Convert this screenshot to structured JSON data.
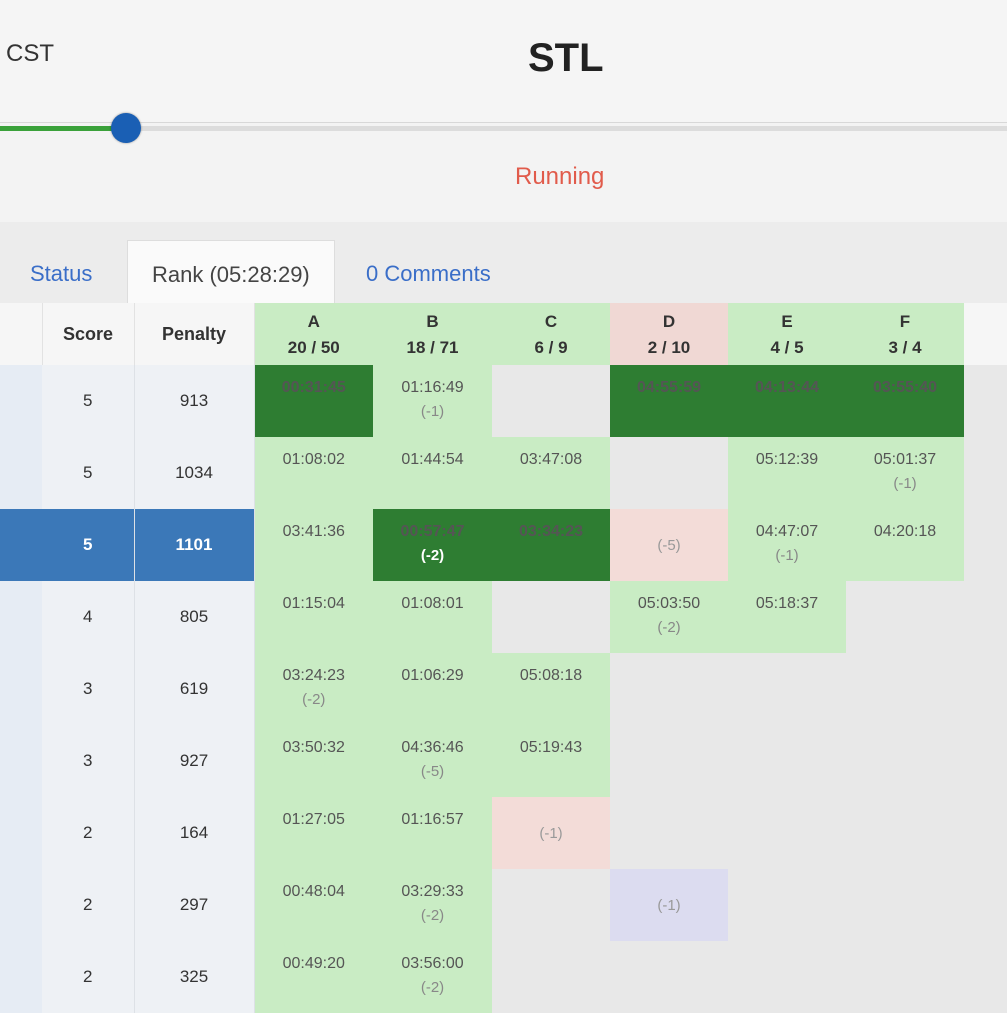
{
  "header": {
    "timezone": "CST",
    "title": "STL",
    "progress": 0.125,
    "status": "Running"
  },
  "tabs": [
    {
      "label": "Status"
    },
    {
      "label": "Rank (05:28:29)"
    },
    {
      "label": "0 Comments"
    }
  ],
  "table": {
    "score_header": "Score",
    "penalty_header": "Penalty",
    "problems": [
      {
        "letter": "A",
        "stats": "20 / 50",
        "state": "solved"
      },
      {
        "letter": "B",
        "stats": "18 / 71",
        "state": "solved"
      },
      {
        "letter": "C",
        "stats": "6 / 9",
        "state": "solved"
      },
      {
        "letter": "D",
        "stats": "2 / 10",
        "state": "unsolved"
      },
      {
        "letter": "E",
        "stats": "4 / 5",
        "state": "solved"
      },
      {
        "letter": "F",
        "stats": "3 / 4",
        "state": "solved"
      }
    ],
    "rows": [
      {
        "score": "5",
        "penalty": "913",
        "highlight": false,
        "cells": [
          {
            "s": "first",
            "t": "00:31:45",
            "n": ""
          },
          {
            "s": "solved",
            "t": "01:16:49",
            "n": "(-1)"
          },
          {
            "s": "empty",
            "t": "",
            "n": ""
          },
          {
            "s": "first",
            "t": "04:55:59",
            "n": ""
          },
          {
            "s": "first",
            "t": "04:13:44",
            "n": ""
          },
          {
            "s": "first",
            "t": "03:55:40",
            "n": ""
          }
        ]
      },
      {
        "score": "5",
        "penalty": "1034",
        "highlight": false,
        "cells": [
          {
            "s": "solved",
            "t": "01:08:02",
            "n": ""
          },
          {
            "s": "solved",
            "t": "01:44:54",
            "n": ""
          },
          {
            "s": "solved",
            "t": "03:47:08",
            "n": ""
          },
          {
            "s": "empty",
            "t": "",
            "n": ""
          },
          {
            "s": "solved",
            "t": "05:12:39",
            "n": ""
          },
          {
            "s": "solved",
            "t": "05:01:37",
            "n": "(-1)"
          }
        ]
      },
      {
        "score": "5",
        "penalty": "1101",
        "highlight": true,
        "cells": [
          {
            "s": "solved",
            "t": "03:41:36",
            "n": ""
          },
          {
            "s": "first",
            "t": "00:57:47",
            "n": "(-2)"
          },
          {
            "s": "first",
            "t": "03:34:23",
            "n": ""
          },
          {
            "s": "failed",
            "t": "",
            "n": "(-5)"
          },
          {
            "s": "solved",
            "t": "04:47:07",
            "n": "(-1)"
          },
          {
            "s": "solved",
            "t": "04:20:18",
            "n": ""
          }
        ]
      },
      {
        "score": "4",
        "penalty": "805",
        "highlight": false,
        "cells": [
          {
            "s": "solved",
            "t": "01:15:04",
            "n": ""
          },
          {
            "s": "solved",
            "t": "01:08:01",
            "n": ""
          },
          {
            "s": "empty",
            "t": "",
            "n": ""
          },
          {
            "s": "solved",
            "t": "05:03:50",
            "n": "(-2)"
          },
          {
            "s": "solved",
            "t": "05:18:37",
            "n": ""
          },
          {
            "s": "empty",
            "t": "",
            "n": ""
          }
        ]
      },
      {
        "score": "3",
        "penalty": "619",
        "highlight": false,
        "cells": [
          {
            "s": "solved",
            "t": "03:24:23",
            "n": "(-2)"
          },
          {
            "s": "solved",
            "t": "01:06:29",
            "n": ""
          },
          {
            "s": "solved",
            "t": "05:08:18",
            "n": ""
          },
          {
            "s": "empty",
            "t": "",
            "n": ""
          },
          {
            "s": "empty",
            "t": "",
            "n": ""
          },
          {
            "s": "empty",
            "t": "",
            "n": ""
          }
        ]
      },
      {
        "score": "3",
        "penalty": "927",
        "highlight": false,
        "cells": [
          {
            "s": "solved",
            "t": "03:50:32",
            "n": ""
          },
          {
            "s": "solved",
            "t": "04:36:46",
            "n": "(-5)"
          },
          {
            "s": "solved",
            "t": "05:19:43",
            "n": ""
          },
          {
            "s": "empty",
            "t": "",
            "n": ""
          },
          {
            "s": "empty",
            "t": "",
            "n": ""
          },
          {
            "s": "empty",
            "t": "",
            "n": ""
          }
        ]
      },
      {
        "score": "2",
        "penalty": "164",
        "highlight": false,
        "cells": [
          {
            "s": "solved",
            "t": "01:27:05",
            "n": ""
          },
          {
            "s": "solved",
            "t": "01:16:57",
            "n": ""
          },
          {
            "s": "failed",
            "t": "",
            "n": "(-1)"
          },
          {
            "s": "empty",
            "t": "",
            "n": ""
          },
          {
            "s": "empty",
            "t": "",
            "n": ""
          },
          {
            "s": "empty",
            "t": "",
            "n": ""
          }
        ]
      },
      {
        "score": "2",
        "penalty": "297",
        "highlight": false,
        "cells": [
          {
            "s": "solved",
            "t": "00:48:04",
            "n": ""
          },
          {
            "s": "solved",
            "t": "03:29:33",
            "n": "(-2)"
          },
          {
            "s": "empty",
            "t": "",
            "n": ""
          },
          {
            "s": "pending",
            "t": "",
            "n": "(-1)"
          },
          {
            "s": "empty",
            "t": "",
            "n": ""
          },
          {
            "s": "empty",
            "t": "",
            "n": ""
          }
        ]
      },
      {
        "score": "2",
        "penalty": "325",
        "highlight": false,
        "cells": [
          {
            "s": "solved",
            "t": "00:49:20",
            "n": ""
          },
          {
            "s": "solved",
            "t": "03:56:00",
            "n": "(-2)"
          },
          {
            "s": "empty",
            "t": "",
            "n": ""
          },
          {
            "s": "empty",
            "t": "",
            "n": ""
          },
          {
            "s": "empty",
            "t": "",
            "n": ""
          },
          {
            "s": "empty",
            "t": "",
            "n": ""
          }
        ]
      }
    ]
  }
}
